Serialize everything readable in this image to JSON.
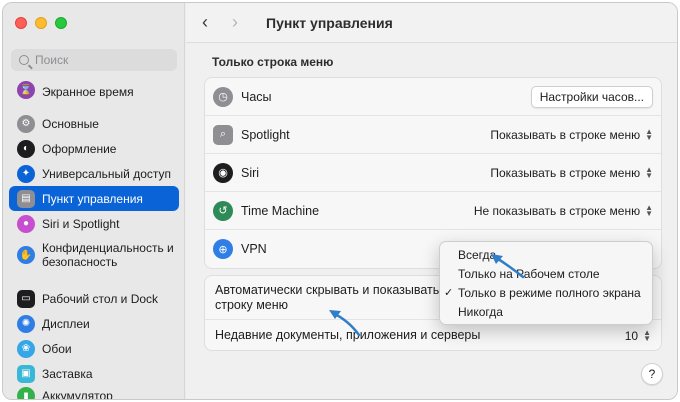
{
  "window": {
    "title": "Пункт управления"
  },
  "colors": {
    "accent": "#0a64d8",
    "arrow": "#2f7ec7"
  },
  "sidebar": {
    "search_placeholder": "Поиск",
    "items": [
      {
        "label": "Экранное время",
        "icon": "hourglass-icon",
        "color": "#8e44ad"
      },
      {
        "label": "Основные",
        "icon": "gear-icon",
        "color": "#8e8e93"
      },
      {
        "label": "Оформление",
        "icon": "appearance-icon",
        "color": "#1d1d1f"
      },
      {
        "label": "Универсальный доступ",
        "icon": "accessibility-icon",
        "color": "#0a64d8"
      },
      {
        "label": "Пункт управления",
        "icon": "control-center-icon",
        "color": "#8e8e93"
      },
      {
        "label": "Siri и Spotlight",
        "icon": "siri-icon",
        "color": "#c64ecf"
      },
      {
        "label": "Конфиденциальность и безопасность",
        "icon": "hand-icon",
        "color": "#2f7ee6"
      },
      {
        "label": "Рабочий стол и Dock",
        "icon": "dock-icon",
        "color": "#1d1d1f"
      },
      {
        "label": "Дисплеи",
        "icon": "display-icon",
        "color": "#2f7ee6"
      },
      {
        "label": "Обои",
        "icon": "wallpaper-icon",
        "color": "#35a7e8"
      },
      {
        "label": "Заставка",
        "icon": "screensaver-icon",
        "color": "#39b7d6"
      },
      {
        "label": "Аккумулятор",
        "icon": "battery-icon",
        "color": "#33b14a"
      }
    ]
  },
  "main": {
    "section_title": "Только строка меню",
    "rows": [
      {
        "label": "Часы",
        "control": "button",
        "value": "Настройки часов...",
        "icon": "clock-icon",
        "color": "#8e8e93"
      },
      {
        "label": "Spotlight",
        "control": "select",
        "value": "Показывать в строке меню",
        "icon": "search-icon",
        "color": "#8e8e93"
      },
      {
        "label": "Siri",
        "control": "select",
        "value": "Показывать в строке меню",
        "icon": "siri-icon",
        "color": "#1d1d1f"
      },
      {
        "label": "Time Machine",
        "control": "select",
        "value": "Не показывать в строке меню",
        "icon": "time-machine-icon",
        "color": "#2e8b57"
      },
      {
        "label": "VPN",
        "control": "none",
        "value": "",
        "icon": "vpn-icon",
        "color": "#2f7ee6"
      }
    ],
    "autohide_label": "Автоматически скрывать и показывать строку меню",
    "recent_label": "Недавние документы, приложения и серверы",
    "recent_value": "10"
  },
  "popup": {
    "options": [
      "Всегда",
      "Только на Рабочем столе",
      "Только в режиме полного экрана",
      "Никогда"
    ],
    "checked_index": 2
  },
  "help_label": "?"
}
